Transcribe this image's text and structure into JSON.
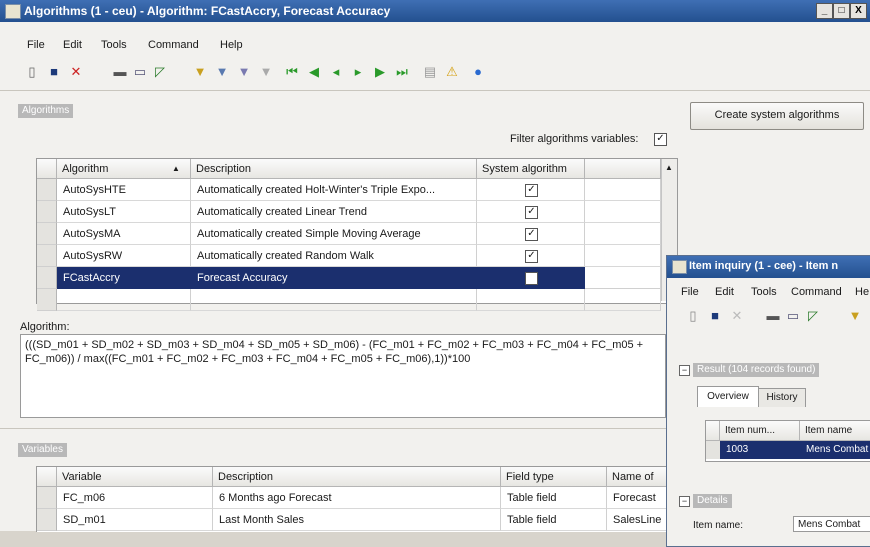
{
  "main": {
    "title": "Algorithms (1 - ceu) - Algorithm: FCastAccry, Forecast Accuracy",
    "window_buttons": [
      "_",
      "□",
      "X"
    ],
    "menu": [
      "File",
      "Edit",
      "Tools",
      "Command",
      "Help"
    ],
    "toolbar_icons": [
      "new-icon",
      "save-icon",
      "delete-icon",
      "print-icon",
      "print-preview-icon",
      "filter-icon",
      "advanced-filter-icon",
      "filter-by-field-icon",
      "filter-by-selection-icon",
      "remove-filter-icon",
      "first-record-icon",
      "previous-page-icon",
      "previous-record-icon",
      "next-record-icon",
      "next-page-icon",
      "last-record-icon",
      "document-handling-icon",
      "alert-icon",
      "help-icon"
    ],
    "algorithms_group": "Algorithms",
    "create_button": "Create system algorithms",
    "filter_label": "Filter algorithms variables:",
    "filter_checked": true,
    "grid": {
      "headers": [
        "Algorithm",
        "Description",
        "System algorithm"
      ],
      "sort_indicator": "▲",
      "rows": [
        {
          "algorithm": "AutoSysHTE",
          "description": "Automatically created Holt-Winter's Triple Expo...",
          "system": true
        },
        {
          "algorithm": "AutoSysLT",
          "description": "Automatically created Linear Trend",
          "system": true
        },
        {
          "algorithm": "AutoSysMA",
          "description": "Automatically created Simple Moving Average",
          "system": true
        },
        {
          "algorithm": "AutoSysRW",
          "description": "Automatically created Random Walk",
          "system": true
        },
        {
          "algorithm": "FCastAccry",
          "description": "Forecast Accuracy",
          "system": false
        }
      ],
      "selected_row": 4
    },
    "algorithm_label": "Algorithm:",
    "algorithm_text": "(((SD_m01 + SD_m02 + SD_m03 + SD_m04 + SD_m05 + SD_m06) - (FC_m01 + FC_m02 + FC_m03 + FC_m04 + FC_m05 + FC_m06)) / max((FC_m01 + FC_m02 + FC_m03 + FC_m04 + FC_m05 + FC_m06),1))*100",
    "variables_group": "Variables",
    "variables_grid": {
      "headers": [
        "Variable",
        "Description",
        "Field type",
        "Name of"
      ],
      "rows": [
        {
          "variable": "FC_m06",
          "description": "6 Months ago Forecast",
          "field_type": "Table field",
          "name": "Forecast"
        },
        {
          "variable": "SD_m01",
          "description": "Last Month Sales",
          "field_type": "Table field",
          "name": "SalesLine"
        }
      ]
    }
  },
  "child": {
    "title": "Item inquiry (1 - cee) - Item n",
    "menu": [
      "File",
      "Edit",
      "Tools",
      "Command",
      "He"
    ],
    "result_group": "Result (104 records found)",
    "tabs": [
      "Overview",
      "History"
    ],
    "headers": [
      "Item num...",
      "Item name"
    ],
    "row": {
      "item_number": "1003",
      "item_name": "Mens Combat"
    },
    "details_group": "Details",
    "item_name_label": "Item name:",
    "item_name_value": "Mens Combat"
  },
  "colors": {
    "title_bar": "#2d5da0",
    "selection": "#1b2f6e"
  }
}
